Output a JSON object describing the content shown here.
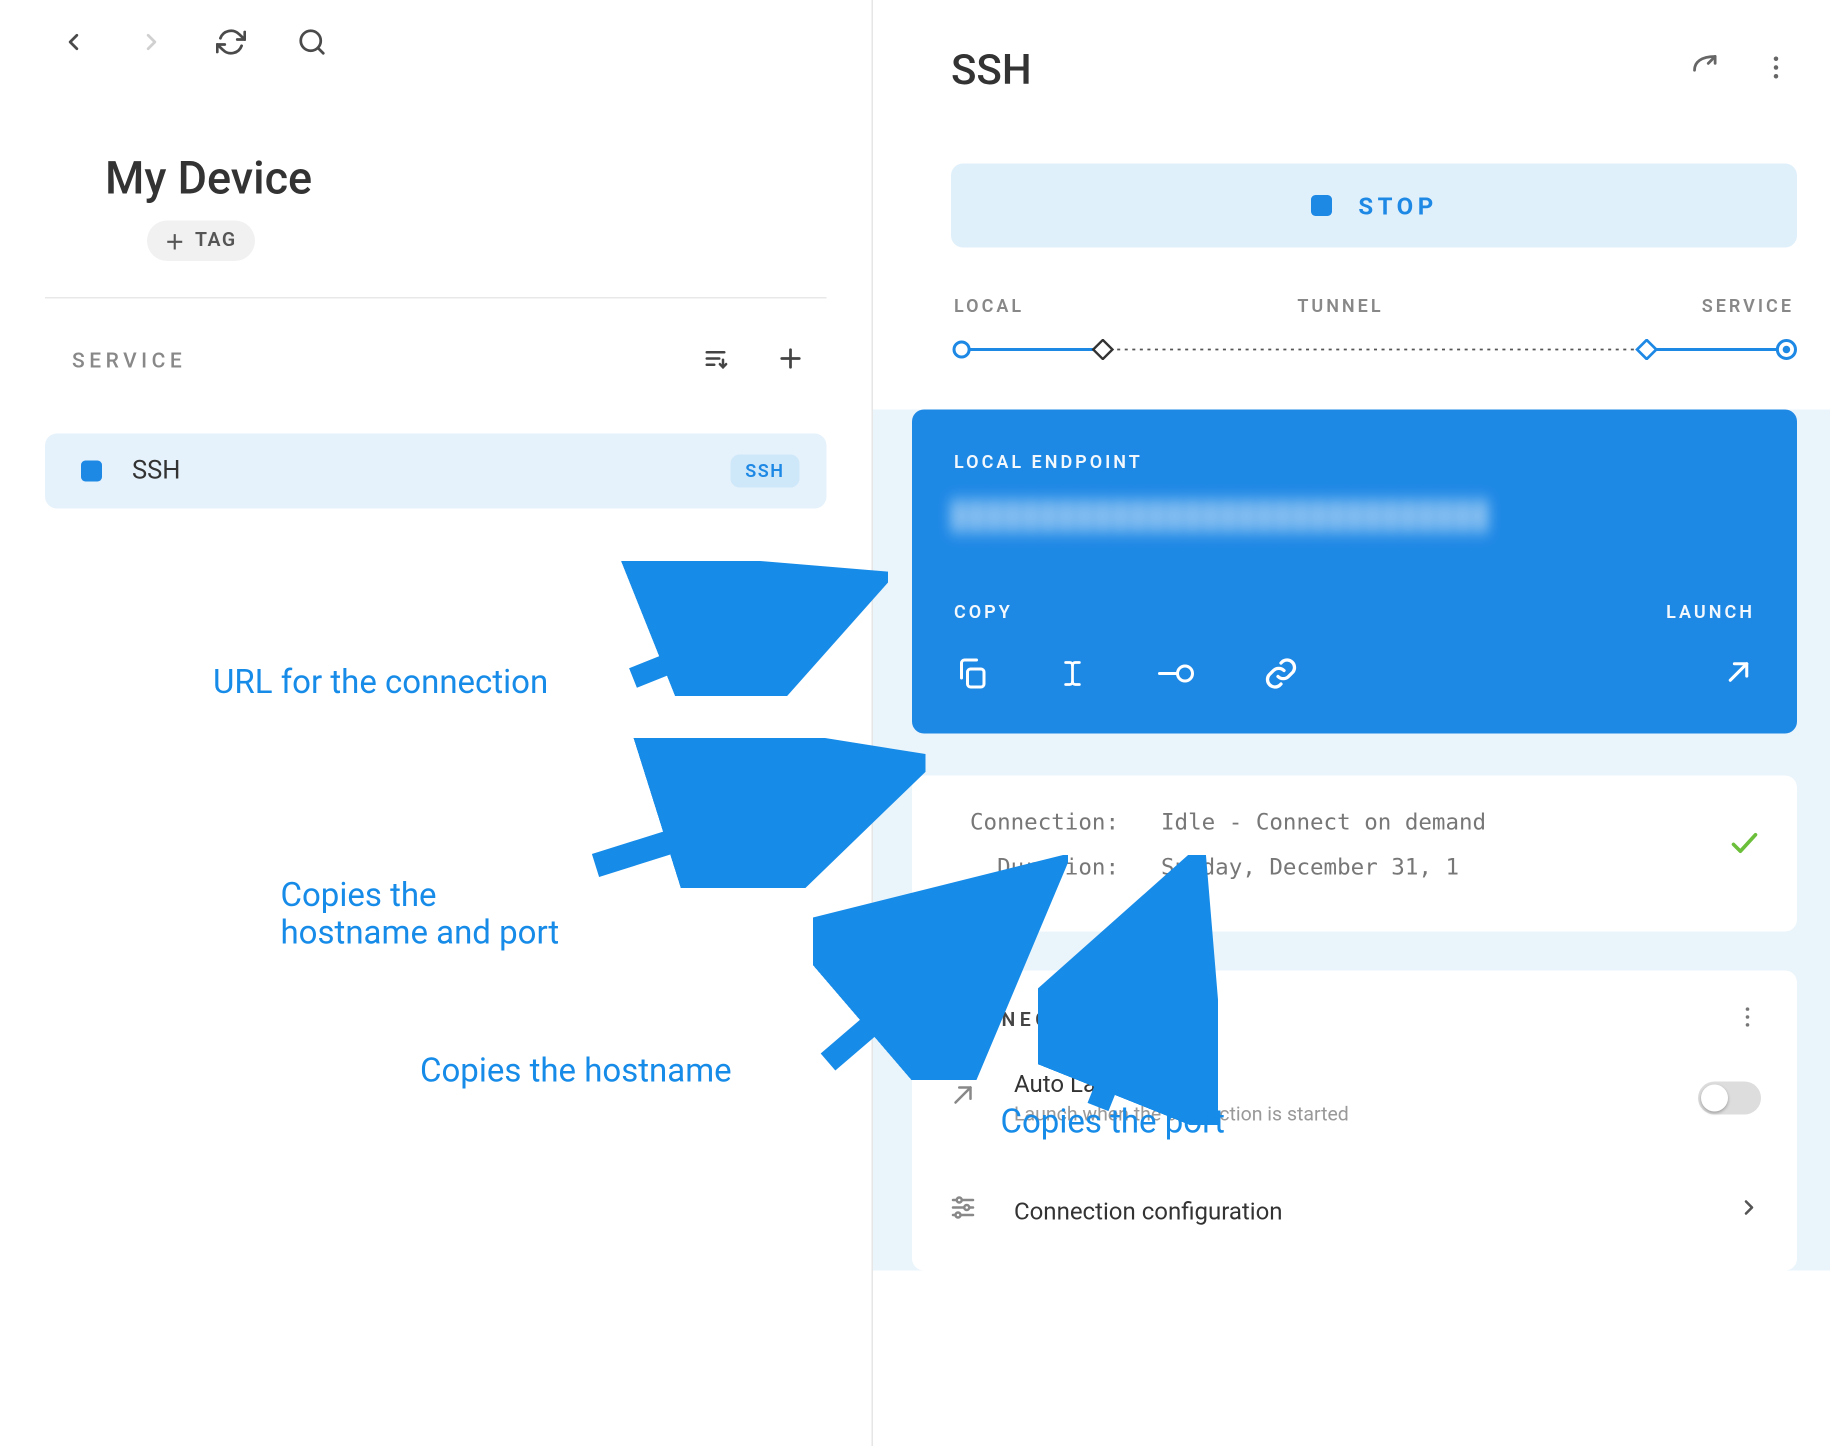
{
  "left": {
    "device_title": "My Device",
    "tag_label": "TAG",
    "service_heading": "SERVICE",
    "service": {
      "name": "SSH",
      "badge": "SSH"
    }
  },
  "right": {
    "title": "SSH",
    "stop_label": "STOP",
    "route": {
      "local": "LOCAL",
      "tunnel": "TUNNEL",
      "service": "SERVICE"
    },
    "endpoint": {
      "label": "LOCAL ENDPOINT",
      "copy_label": "COPY",
      "launch_label": "LAUNCH"
    },
    "details": {
      "connection_key": "Connection:",
      "connection_val": "Idle - Connect on demand",
      "duration_key": "Duration:",
      "duration_val": "Sunday, December 31, 1"
    },
    "connection": {
      "heading": "CONNECTION",
      "auto_launch_title": "Auto Launch",
      "auto_launch_desc": "Launch when the connection is started",
      "config_title": "Connection configuration"
    }
  },
  "annotations": {
    "url": "URL for the connection",
    "host_port": "Copies the\nhostname and port",
    "hostname": "Copies the hostname",
    "port": "Copies the port"
  }
}
